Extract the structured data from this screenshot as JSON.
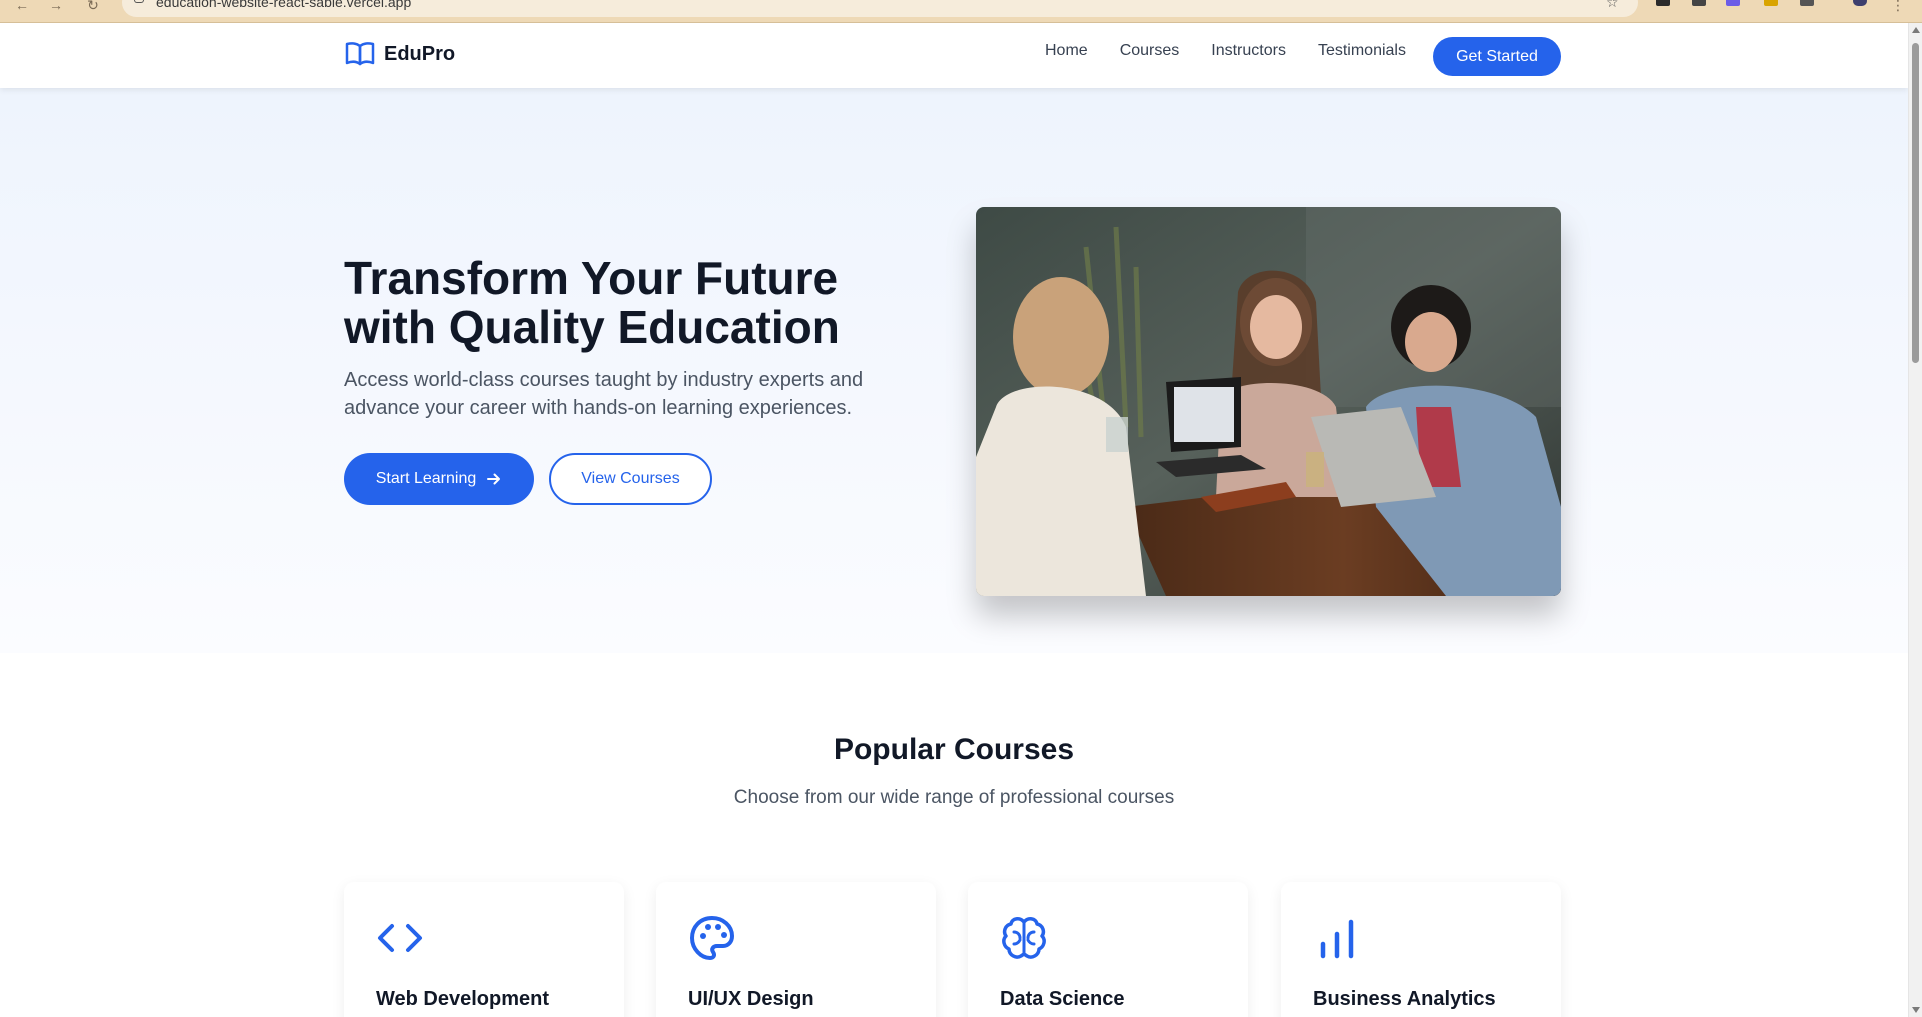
{
  "browser": {
    "url": "education-website-react-sable.vercel.app"
  },
  "header": {
    "brand": "EduPro",
    "nav": [
      "Home",
      "Courses",
      "Instructors",
      "Testimonials"
    ],
    "cta": "Get Started"
  },
  "hero": {
    "title": "Transform Your Future with Quality Education",
    "subtitle": "Access world-class courses taught by industry experts and advance your career with hands-on learning experiences.",
    "primary_button": "Start Learning",
    "secondary_button": "View Courses",
    "image_icon": "students-at-table-photo"
  },
  "courses": {
    "title": "Popular Courses",
    "subtitle": "Choose from our wide range of professional courses",
    "items": [
      {
        "title": "Web Development",
        "icon": "code-icon"
      },
      {
        "title": "UI/UX Design",
        "icon": "palette-icon"
      },
      {
        "title": "Data Science",
        "icon": "brain-icon"
      },
      {
        "title": "Business Analytics",
        "icon": "bar-chart-icon"
      }
    ]
  },
  "colors": {
    "primary": "#2563eb",
    "text": "#111827",
    "muted": "#4b5563",
    "hero_bg": "#eef4fd"
  }
}
